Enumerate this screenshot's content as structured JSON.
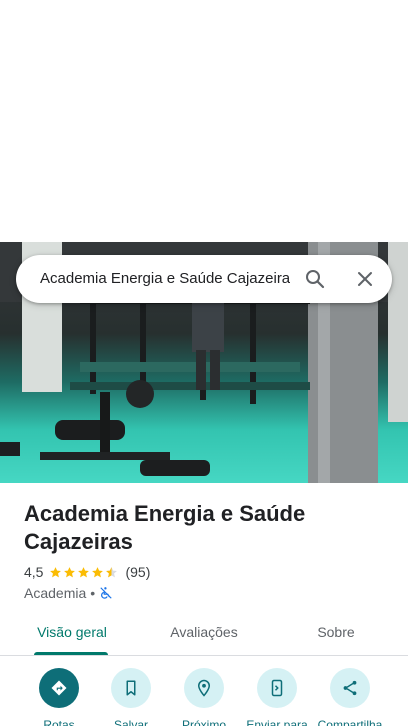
{
  "search": {
    "query": "Academia Energia e Saúde Cajazeiras"
  },
  "place": {
    "title": "Academia Energia e Saúde Cajazeiras",
    "rating": "4,5",
    "reviews_count": "(95)",
    "category": "Academia",
    "separator": "•"
  },
  "tabs": [
    {
      "label": "Visão geral",
      "active": true
    },
    {
      "label": "Avaliações",
      "active": false
    },
    {
      "label": "Sobre",
      "active": false
    }
  ],
  "actions": [
    {
      "label": "Rotas",
      "icon": "directions-icon"
    },
    {
      "label": "Salvar",
      "icon": "bookmark-icon"
    },
    {
      "label": "Próximo",
      "icon": "nearby-icon"
    },
    {
      "label": "Enviar para",
      "icon": "send-to-phone-icon"
    },
    {
      "label": "Compartilha",
      "icon": "share-icon"
    }
  ],
  "colors": {
    "accent": "#00796b",
    "action_bg": "#d5f1f4",
    "primary_action": "#0e6e78",
    "star": "#fbbc04"
  }
}
